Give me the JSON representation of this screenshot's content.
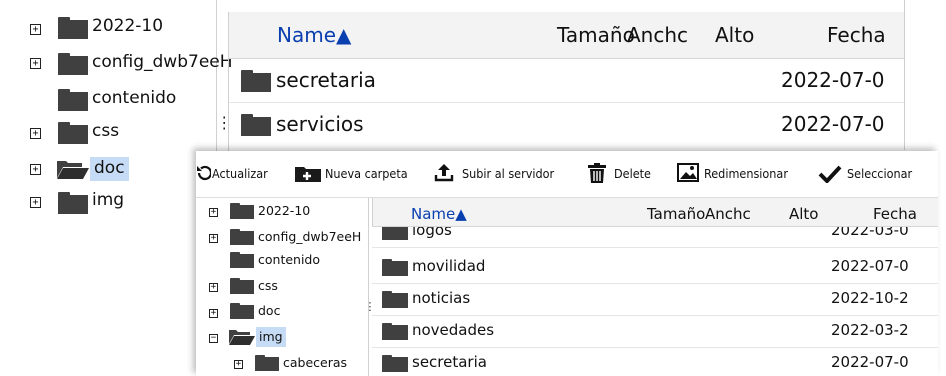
{
  "back_window": {
    "tree": [
      {
        "label": "2022-10",
        "expander": "+"
      },
      {
        "label": "config_dwb7eeH",
        "expander": "+"
      },
      {
        "label": "contenido",
        "expander": ""
      },
      {
        "label": "css",
        "expander": "+"
      },
      {
        "label": "doc",
        "expander": "+",
        "selected": true,
        "open": true
      },
      {
        "label": "img",
        "expander": "+"
      }
    ],
    "splitter": "⋮",
    "headers": {
      "name": "Name",
      "sort": "▲",
      "size": "Tamaño",
      "width": "Anchc",
      "height": "Alto",
      "date": "Fecha"
    },
    "rows": [
      {
        "name": "secretaria",
        "date": "2022-07-0"
      },
      {
        "name": "servicios",
        "date": "2022-07-0"
      }
    ]
  },
  "front_window": {
    "toolbar": {
      "refresh": "Actualizar",
      "new_folder": "Nueva carpeta",
      "upload": "Subir al servidor",
      "delete": "Delete",
      "resize": "Redimensionar",
      "select": "Seleccionar"
    },
    "tree": [
      {
        "label": "2022-10",
        "expander": "+"
      },
      {
        "label": "config_dwb7eeH",
        "expander": "+"
      },
      {
        "label": "contenido",
        "expander": ""
      },
      {
        "label": "css",
        "expander": "+"
      },
      {
        "label": "doc",
        "expander": "+"
      },
      {
        "label": "img",
        "expander": "−",
        "selected": true,
        "open": true
      },
      {
        "label": "cabeceras",
        "expander": "+",
        "child": true
      }
    ],
    "splitter": "⋮",
    "headers": {
      "name": "Name",
      "sort": "▲",
      "size": "Tamaño",
      "width": "Anchc",
      "height": "Alto",
      "date": "Fecha"
    },
    "rows": [
      {
        "name": "logos",
        "date": "2022-03-0"
      },
      {
        "name": "movilidad",
        "date": "2022-07-0"
      },
      {
        "name": "noticias",
        "date": "2022-10-2"
      },
      {
        "name": "novedades",
        "date": "2022-03-2"
      },
      {
        "name": "secretaria",
        "date": "2022-07-0"
      }
    ]
  },
  "colors": {
    "accent": "#0a3fb0",
    "selected_bg": "#c6dcf6",
    "folder": "#404040",
    "header_bg": "#f3f3f3"
  }
}
